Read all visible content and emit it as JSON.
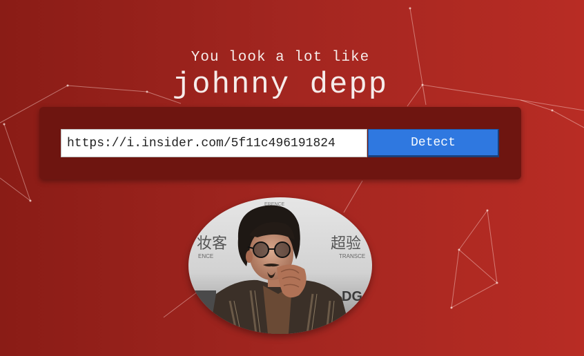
{
  "header": {
    "subtitle": "You look a lot like",
    "name": "johnny depp"
  },
  "form": {
    "url_value": "https://i.insider.com/5f11c496191824",
    "detect_label": "Detect"
  },
  "photo": {
    "banner_text_left": "ENCE",
    "banner_text_right": "TRANSCE",
    "banner_text_top": "ERENCE",
    "logo_text": "DG",
    "cjk_left": "妆客",
    "cjk_right": "超验"
  },
  "colors": {
    "background_left": "#8a1c16",
    "background_right": "#b82c24",
    "panel": "#6e1510",
    "button": "#2f78e0"
  }
}
